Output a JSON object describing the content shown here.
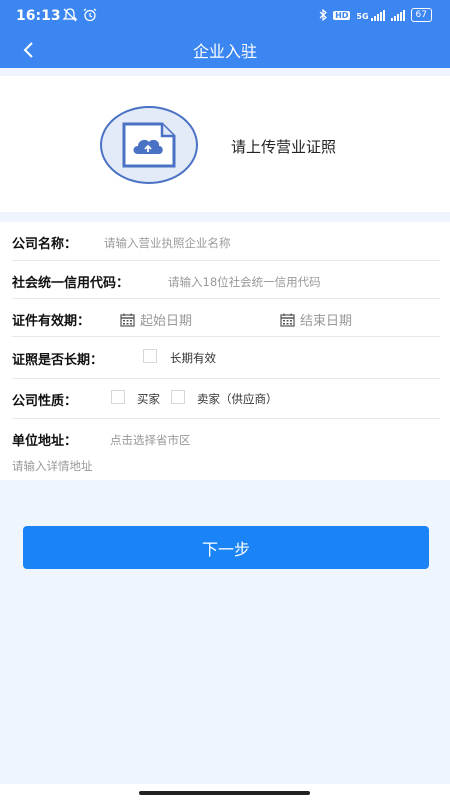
{
  "status": {
    "time": "16:13",
    "left_icons": [
      "muted-notification-icon",
      "alarm-icon"
    ],
    "right_icons": [
      "bluetooth-icon",
      "hd-icon",
      "5g-signal-icon",
      "signal-icon",
      "battery-icon"
    ],
    "hd": "HD",
    "network": "5G",
    "battery": "67"
  },
  "nav": {
    "title": "企业入驻",
    "back_icon": "chevron-left-icon"
  },
  "upload": {
    "label": "请上传营业证照",
    "icon": "cloud-upload-icon"
  },
  "form": {
    "company_name": {
      "label": "公司名称：",
      "placeholder": "请输入营业执照企业名称"
    },
    "credit_code": {
      "label": "社会统一信用代码：",
      "placeholder": "请输入18位社会统一信用代码"
    },
    "validity": {
      "label": "证件有效期：",
      "start_placeholder": "起始日期",
      "end_placeholder": "结束日期",
      "icon": "calendar-icon"
    },
    "long_term": {
      "label": "证照是否长期：",
      "option": "长期有效"
    },
    "company_type": {
      "label": "公司性质：",
      "options": [
        "买家",
        "卖家（供应商）"
      ]
    },
    "address": {
      "label": "单位地址：",
      "region_placeholder": "点击选择省市区",
      "detail_placeholder": "请输入详情地址"
    }
  },
  "next_button": "下一步",
  "colors": {
    "primary": "#3b86f1",
    "button": "#1a84f6",
    "page_bg": "#eef5fc"
  }
}
